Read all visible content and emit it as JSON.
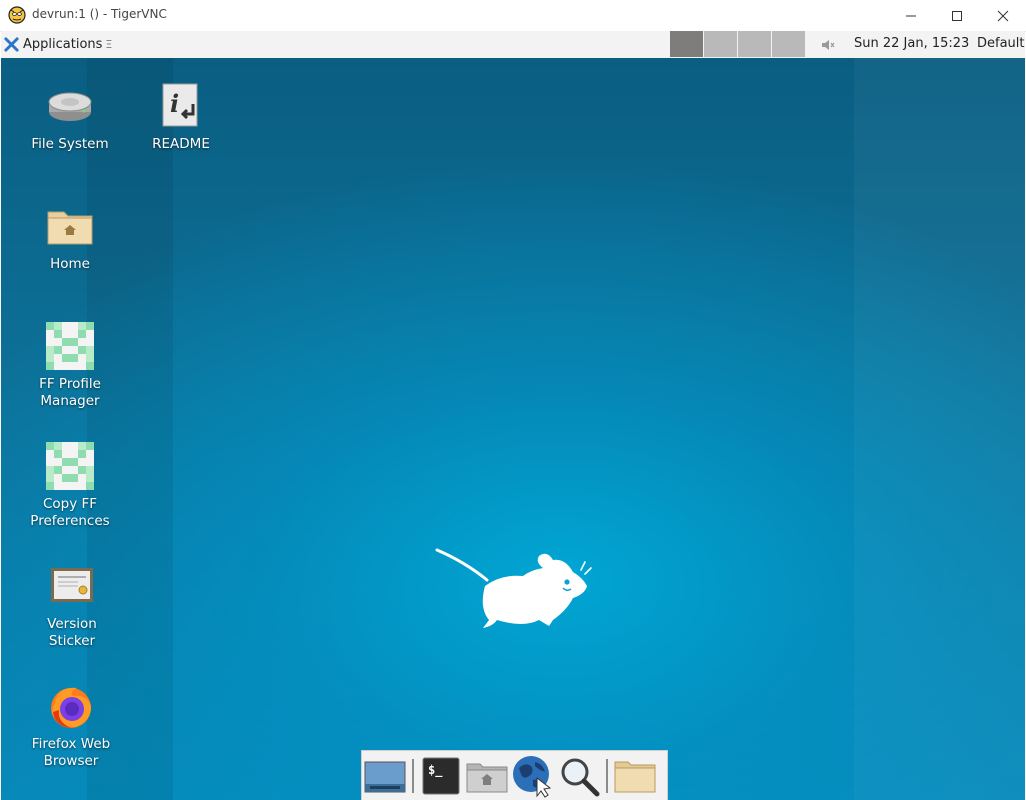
{
  "window": {
    "title": "devrun:1 () - TigerVNC",
    "controls": {
      "minimize": "minimize",
      "maximize": "maximize",
      "close": "close"
    }
  },
  "panel": {
    "applications_label": "Applications",
    "applications_glyph": "Ξ",
    "workspaces": [
      {
        "name": "workspace-1",
        "active": true
      },
      {
        "name": "workspace-2",
        "active": false
      },
      {
        "name": "workspace-3",
        "active": false
      },
      {
        "name": "workspace-4",
        "active": false
      }
    ],
    "clock": "Sun 22 Jan, 15:23",
    "user": "Default"
  },
  "desktop": {
    "icons": [
      {
        "label": "File System",
        "icon": "hard-drive-icon"
      },
      {
        "label": "README",
        "icon": "info-document-icon"
      },
      {
        "label": "Home",
        "icon": "home-folder-icon"
      },
      {
        "label": "FF Profile\nManager",
        "icon": "ff-profile-icon"
      },
      {
        "label": "Copy FF\nPreferences",
        "icon": "ff-preferences-icon"
      },
      {
        "label": "Version\nSticker",
        "icon": "certificate-icon"
      },
      {
        "label": "Firefox Web\nBrowser",
        "icon": "firefox-icon"
      }
    ]
  },
  "dock": {
    "items": [
      {
        "name": "show-desktop",
        "icon": "show-desktop-icon"
      },
      {
        "name": "terminal",
        "icon": "terminal-icon"
      },
      {
        "name": "file-manager",
        "icon": "home-folder-icon"
      },
      {
        "name": "web-browser",
        "icon": "globe-icon"
      },
      {
        "name": "app-finder",
        "icon": "magnifier-icon"
      },
      {
        "name": "folder",
        "icon": "folder-icon"
      }
    ]
  },
  "colors": {
    "desktop_top": "#0a5e82",
    "desktop_glow": "#00a8d6",
    "panel_bg": "#f3f3f3",
    "workspace_active": "#7e7d7b",
    "workspace_inactive": "#b9b9b9"
  }
}
